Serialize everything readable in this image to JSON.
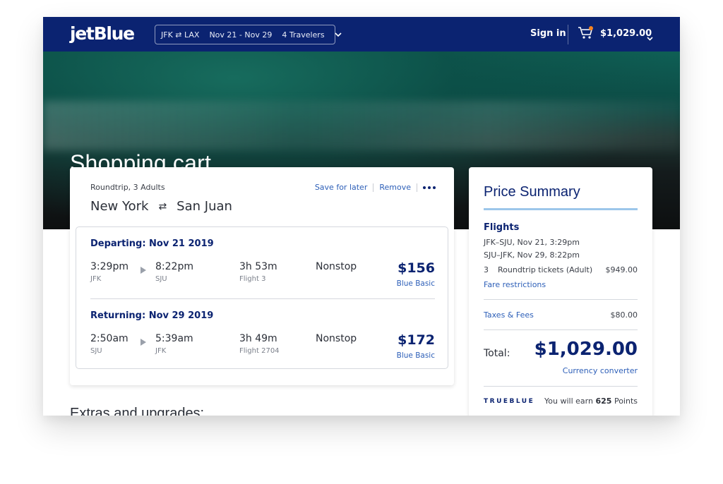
{
  "header": {
    "logo": "jetBlue",
    "search": {
      "route": "JFK ⇄ LAX",
      "dates": "Nov 21 - Nov 29",
      "travelers": "4 Travelers"
    },
    "sign_in": "Sign in",
    "cart_total": "$1,029.00",
    "brand_color": "#0b2371"
  },
  "hero": {
    "title": "Shopping cart"
  },
  "trip": {
    "meta": "Roundtrip, 3 Adults",
    "actions": {
      "save": "Save for later",
      "remove": "Remove"
    },
    "origin": "New York",
    "swap": "⇄",
    "destination": "San Juan",
    "legs": [
      {
        "heading": "Departing: Nov 21 2019",
        "depart_time": "3:29pm",
        "depart_code": "JFK",
        "arrive_time": "8:22pm",
        "arrive_code": "SJU",
        "duration": "3h 53m",
        "flight": "Flight 3",
        "stops": "Nonstop",
        "price": "$156",
        "fare": "Blue Basic"
      },
      {
        "heading": "Returning: Nov 29 2019",
        "depart_time": "2:50am",
        "depart_code": "SJU",
        "arrive_time": "5:39am",
        "arrive_code": "JFK",
        "duration": "3h 49m",
        "flight": "Flight 2704",
        "stops": "Nonstop",
        "price": "$172",
        "fare": "Blue Basic"
      }
    ]
  },
  "extras": {
    "title": "Extras and upgrades:"
  },
  "summary": {
    "title": "Price Summary",
    "flights_label": "Flights",
    "outbound": "JFK–SJU, Nov 21, 3:29pm",
    "inbound": "SJU–JFK, Nov 29, 8:22pm",
    "tickets_qty": "3",
    "tickets_label": "Roundtrip tickets (Adult)",
    "tickets_amount": "$949.00",
    "fare_restrictions": "Fare restrictions",
    "taxes_label": "Taxes & Fees",
    "taxes_amount": "$80.00",
    "total_label": "Total:",
    "total_amount": "$1,029.00",
    "currency_converter": "Currency converter",
    "trueblue_logo": "TRUEBLUE",
    "earn_prefix": "You will earn",
    "earn_points": "625",
    "earn_suffix": "Points"
  }
}
